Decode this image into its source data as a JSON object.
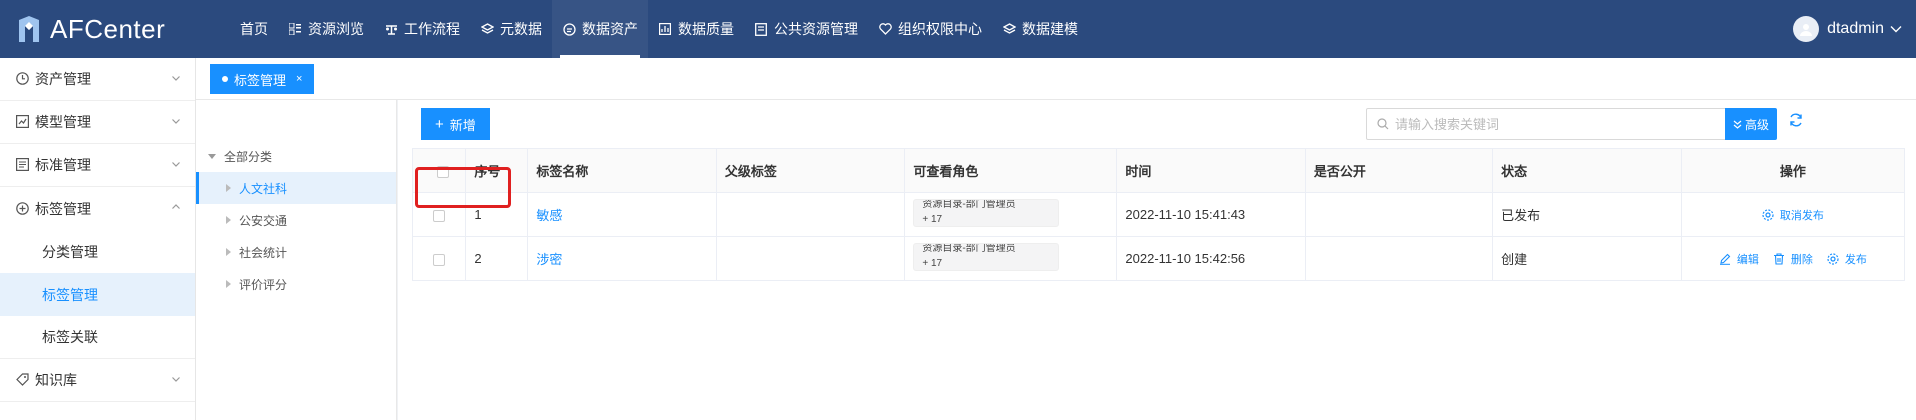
{
  "app": {
    "title": "AFCenter"
  },
  "nav": {
    "items": [
      {
        "label": "首页",
        "icon": ""
      },
      {
        "label": "资源浏览",
        "icon": "grid-icon"
      },
      {
        "label": "工作流程",
        "icon": "flow-icon"
      },
      {
        "label": "元数据",
        "icon": "layers-icon"
      },
      {
        "label": "数据资产",
        "icon": "asset-icon",
        "active": true
      },
      {
        "label": "数据质量",
        "icon": "chart-icon"
      },
      {
        "label": "公共资源管理",
        "icon": "book-icon"
      },
      {
        "label": "组织权限中心",
        "icon": "shield-icon"
      },
      {
        "label": "数据建模",
        "icon": "layers-icon"
      }
    ]
  },
  "user": {
    "name": "dtadmin"
  },
  "sidebar": {
    "items": [
      {
        "label": "资产管理",
        "icon": "clock-icon"
      },
      {
        "label": "模型管理",
        "icon": "chart-icon"
      },
      {
        "label": "标准管理",
        "icon": "doc-icon"
      },
      {
        "label": "标签管理",
        "icon": "plus-circle-icon",
        "expanded": true
      }
    ],
    "sub_items": [
      {
        "label": "分类管理"
      },
      {
        "label": "标签管理",
        "active": true
      },
      {
        "label": "标签关联"
      }
    ],
    "last_item": {
      "label": "知识库",
      "icon": "tag-icon"
    }
  },
  "tabs": [
    {
      "label": "标签管理",
      "close": "×"
    }
  ],
  "tree": {
    "root": "全部分类",
    "children": [
      {
        "label": "人文社科",
        "active": true
      },
      {
        "label": "公安交通"
      },
      {
        "label": "社会统计"
      },
      {
        "label": "评价评分"
      }
    ]
  },
  "toolbar": {
    "add_label": "新增",
    "search_placeholder": "请输入搜索关键词",
    "advanced_label": "高级"
  },
  "table": {
    "headers": [
      "序号",
      "标签名称",
      "父级标签",
      "可查看角色",
      "时间",
      "是否公开",
      "状态",
      "操作"
    ],
    "rows": [
      {
        "index": "1",
        "name": "敏感",
        "parent": "",
        "roles_line1": "资源目录-部门管理员",
        "roles_more": "+ 17",
        "time": "2022-11-10 15:41:43",
        "public": "",
        "status": "已发布",
        "ops": [
          {
            "label": "取消发布",
            "icon": "gear-icon"
          }
        ]
      },
      {
        "index": "2",
        "name": "涉密",
        "parent": "",
        "roles_line1": "资源目录-部门管理员",
        "roles_more": "+ 17",
        "time": "2022-11-10 15:42:56",
        "public": "",
        "status": "创建",
        "ops": [
          {
            "label": "编辑",
            "icon": "edit-icon"
          },
          {
            "label": "删除",
            "icon": "trash-icon"
          },
          {
            "label": "发布",
            "icon": "gear-icon"
          }
        ]
      }
    ]
  },
  "colors": {
    "topbar": "#2b4a7e",
    "accent": "#1890ff",
    "highlight": "#e02020"
  }
}
